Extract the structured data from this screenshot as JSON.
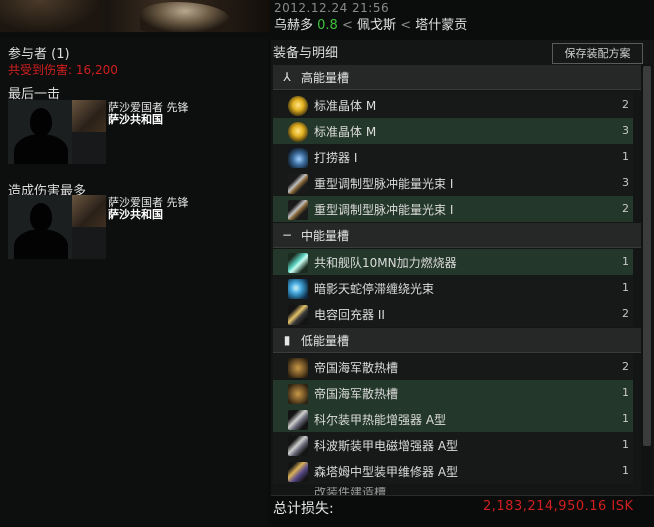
{
  "header": {
    "datetime": "2012.12.24 21:56",
    "system": "乌赫多",
    "security": "0.8",
    "region": "佩戈斯",
    "constellation": "塔什蒙贡",
    "separator": "<"
  },
  "participants": {
    "title": "参与者 (1)",
    "damage_taken": "共受到伤害: 16,200",
    "final_blow_title": "最后一击",
    "top_damage_title": "造成伤害最多",
    "final_blow": {
      "name": "萨沙爱国者",
      "role": "先锋",
      "corp": "萨沙共和国"
    },
    "top_damage": {
      "name": "萨沙爱国者",
      "role": "先锋",
      "corp": "萨沙共和国"
    }
  },
  "fitting": {
    "title": "装备与明细",
    "save_button": "保存装配方案",
    "slots": [
      {
        "label": "高能量槽",
        "icon": "high-slot-icon",
        "items": [
          {
            "name": "标准晶体 M",
            "qty": "2",
            "icon": "crystal-icon",
            "highlight": false
          },
          {
            "name": "标准晶体 M",
            "qty": "3",
            "icon": "crystal-icon",
            "highlight": true
          },
          {
            "name": "打捞器 I",
            "qty": "1",
            "icon": "salvager-icon",
            "highlight": false
          },
          {
            "name": "重型调制型脉冲能量光束 I",
            "qty": "3",
            "icon": "laser-icon",
            "highlight": false
          },
          {
            "name": "重型调制型脉冲能量光束 I",
            "qty": "2",
            "icon": "laser-icon",
            "highlight": true
          }
        ]
      },
      {
        "label": "中能量槽",
        "icon": "mid-slot-icon",
        "items": [
          {
            "name": "共和舰队10MN加力燃烧器",
            "qty": "1",
            "icon": "afterburner-icon",
            "highlight": true
          },
          {
            "name": "暗影天蛇停滞缠绕光束",
            "qty": "1",
            "icon": "webifier-icon",
            "highlight": false
          },
          {
            "name": "电容回充器 II",
            "qty": "2",
            "icon": "cap-recharger-icon",
            "highlight": false
          }
        ]
      },
      {
        "label": "低能量槽",
        "icon": "low-slot-icon",
        "items": [
          {
            "name": "帝国海军散热槽",
            "qty": "2",
            "icon": "heat-sink-icon",
            "highlight": false
          },
          {
            "name": "帝国海军散热槽",
            "qty": "1",
            "icon": "heat-sink-icon",
            "highlight": true
          },
          {
            "name": "科尔装甲热能增强器 A型",
            "qty": "1",
            "icon": "armor-hardener-icon",
            "highlight": true
          },
          {
            "name": "科波斯装甲电磁增强器 A型",
            "qty": "1",
            "icon": "armor-hardener-icon",
            "highlight": false
          },
          {
            "name": "森塔姆中型装甲维修器 A型",
            "qty": "1",
            "icon": "armor-repairer-icon",
            "highlight": false
          }
        ]
      }
    ],
    "partial_row": "改装件建造槽"
  },
  "footer": {
    "total_loss_label": "总计损失:",
    "total_loss_value": "2,183,214,950.16 ISK"
  },
  "colors": {
    "security": "#3ec43e",
    "loss": "#d11f1f",
    "row_highlight": "#23372a"
  }
}
